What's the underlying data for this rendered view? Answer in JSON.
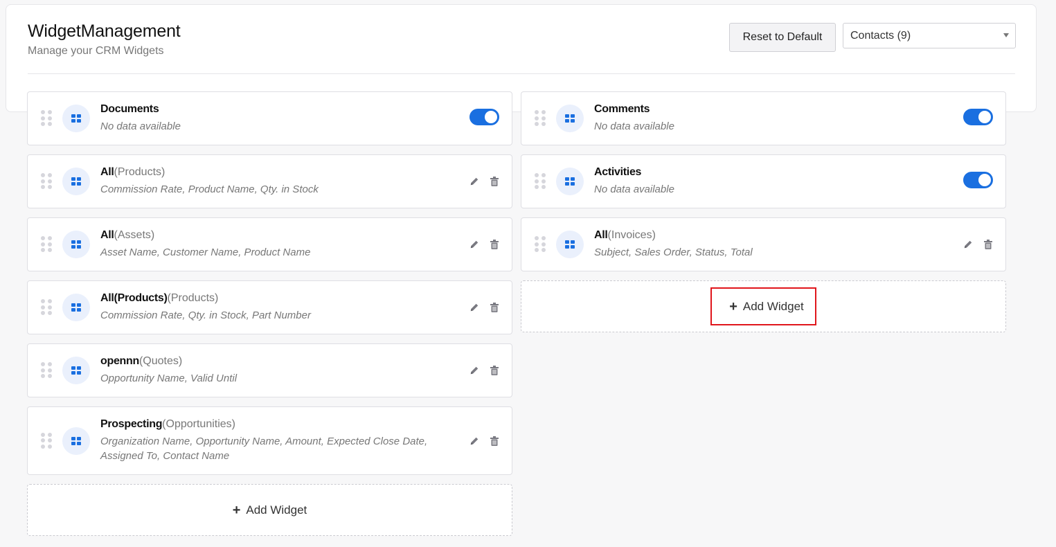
{
  "header": {
    "title": "WidgetManagement",
    "subtitle": "Manage your CRM Widgets",
    "reset_label": "Reset to Default",
    "module_selected": "Contacts (9)"
  },
  "left_column": [
    {
      "name": "Documents",
      "module": "",
      "desc": "No data available",
      "control": "toggle",
      "enabled": true
    },
    {
      "name": "All",
      "module": "(Products)",
      "desc": "Commission Rate, Product Name, Qty. in Stock",
      "control": "actions"
    },
    {
      "name": "All",
      "module": "(Assets)",
      "desc": "Asset Name, Customer Name, Product Name",
      "control": "actions"
    },
    {
      "name": "All(Products)",
      "module": "(Products)",
      "desc": "Commission Rate, Qty. in Stock, Part Number",
      "control": "actions"
    },
    {
      "name": "opennn",
      "module": "(Quotes)",
      "desc": "Opportunity Name, Valid Until",
      "control": "actions"
    },
    {
      "name": "Prospecting",
      "module": "(Opportunities)",
      "desc": "Organization Name, Opportunity Name, Amount, Expected Close Date, Assigned To, Contact Name",
      "control": "actions"
    }
  ],
  "right_column": [
    {
      "name": "Comments",
      "module": "",
      "desc": "No data available",
      "control": "toggle",
      "enabled": true
    },
    {
      "name": "Activities",
      "module": "",
      "desc": "No data available",
      "control": "toggle",
      "enabled": true
    },
    {
      "name": "All",
      "module": "(Invoices)",
      "desc": "Subject, Sales Order, Status, Total",
      "control": "actions"
    }
  ],
  "add_widget_label": "Add Widget",
  "colors": {
    "accent": "#1a6fe0",
    "highlight_border": "#e0151b"
  },
  "icons": {
    "widget": "grid-icon",
    "drag": "drag-handle-icon",
    "edit": "pencil-icon",
    "delete": "trash-icon",
    "add": "plus-icon"
  }
}
